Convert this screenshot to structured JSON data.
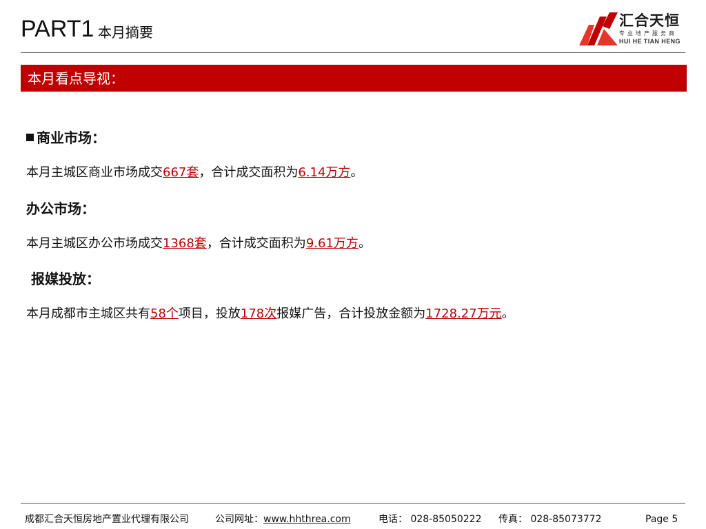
{
  "header": {
    "part": "PART1",
    "subtitle": "本月摘要"
  },
  "logo": {
    "name": "汇合天恒",
    "tagline": "专业地产服务商",
    "pinyin": "HUI HE TIAN HENG",
    "colors": {
      "primary": "#c00000",
      "secondary": "#e8352a"
    }
  },
  "banner": {
    "text": "本月看点导视："
  },
  "sections": [
    {
      "heading": "商业市场：",
      "line": {
        "pre": "本月主城区商业市场成交",
        "v1": "667套",
        "mid": "，合计成交面积为",
        "v2": "6.14万方",
        "post": "。"
      }
    },
    {
      "heading": "办公市场：",
      "line": {
        "pre": "本月主城区办公市场成交",
        "v1": "1368套",
        "mid": "，合计成交面积为",
        "v2": "9.61万方",
        "post": "。"
      }
    },
    {
      "heading": "报媒投放：",
      "line": {
        "pre": "本月成都市主城区共有",
        "v1": "58个",
        "mid1": "项目，投放",
        "v2": "178次",
        "mid2": "报媒广告，合计投放金额为",
        "v3": "1728.27万元",
        "post": "。"
      }
    }
  ],
  "footer": {
    "company": "成都汇合天恒房地产置业代理有限公司",
    "website_label": "公司网址：",
    "website": "www.hhthrea.com",
    "phone": "电话： 028-85050222",
    "fax": "传真： 028-85073772",
    "page": "Page 5"
  },
  "colors": {
    "accent": "#c00000",
    "text": "#111111",
    "banner_text": "#ffffff"
  }
}
